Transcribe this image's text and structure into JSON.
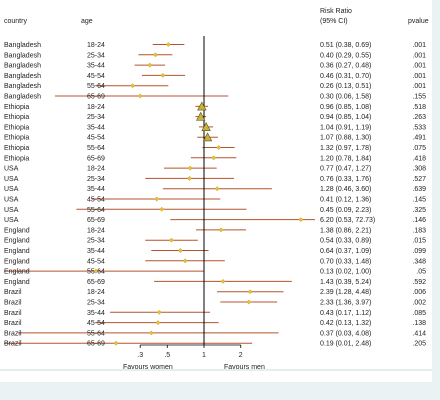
{
  "chart_data": {
    "type": "forest",
    "headers": {
      "country": "country",
      "age": "age",
      "rr_line1": "Risk Ratio",
      "rr_line2": "(95% CI)",
      "pvalue": "pvalue"
    },
    "x_axis": {
      "scale": "log",
      "ticks": [
        {
          "value": 0.3,
          "label": ".3"
        },
        {
          "value": 0.5,
          "label": ".5"
        },
        {
          "value": 1,
          "label": "1"
        },
        {
          "value": 2,
          "label": "2"
        }
      ],
      "reference_line": 1,
      "left_label": "Favours women",
      "right_label": "Favours men"
    },
    "rows": [
      {
        "country": "Bangladesh",
        "age": "18-24",
        "rr": 0.51,
        "lo": 0.38,
        "hi": 0.69,
        "ci_text": "0.51 (0.38, 0.69)",
        "p": ".001",
        "marker": "diamond"
      },
      {
        "country": "Bangladesh",
        "age": "25-34",
        "rr": 0.4,
        "lo": 0.29,
        "hi": 0.55,
        "ci_text": "0.40 (0.29, 0.55)",
        "p": ".001",
        "marker": "diamond"
      },
      {
        "country": "Bangladesh",
        "age": "35-44",
        "rr": 0.36,
        "lo": 0.27,
        "hi": 0.48,
        "ci_text": "0.36 (0.27, 0.48)",
        "p": ".001",
        "marker": "diamond"
      },
      {
        "country": "Bangladesh",
        "age": "45-54",
        "rr": 0.46,
        "lo": 0.31,
        "hi": 0.7,
        "ci_text": "0.46 (0.31, 0.70)",
        "p": ".001",
        "marker": "diamond"
      },
      {
        "country": "Bangladesh",
        "age": "55-64",
        "rr": 0.26,
        "lo": 0.13,
        "hi": 0.51,
        "ci_text": "0.26 (0.13, 0.51)",
        "p": ".001",
        "marker": "diamond"
      },
      {
        "country": "Bangladesh",
        "age": "65-69",
        "rr": 0.3,
        "lo": 0.06,
        "hi": 1.58,
        "ci_text": "0.30 (0.06, 1.58)",
        "p": ".155",
        "marker": "diamond"
      },
      {
        "country": "Ethiopia",
        "age": "18-24",
        "rr": 0.96,
        "lo": 0.85,
        "hi": 1.08,
        "ci_text": "0.96 (0.85, 1.08)",
        "p": ".518",
        "marker": "triangle"
      },
      {
        "country": "Ethiopia",
        "age": "25-34",
        "rr": 0.94,
        "lo": 0.85,
        "hi": 1.04,
        "ci_text": "0.94 (0.85, 1.04)",
        "p": ".263",
        "marker": "triangle"
      },
      {
        "country": "Ethiopia",
        "age": "35-44",
        "rr": 1.04,
        "lo": 0.91,
        "hi": 1.19,
        "ci_text": "1.04 (0.91, 1.19)",
        "p": ".533",
        "marker": "triangle"
      },
      {
        "country": "Ethiopia",
        "age": "45-54",
        "rr": 1.07,
        "lo": 0.88,
        "hi": 1.3,
        "ci_text": "1.07 (0.88, 1.30)",
        "p": ".491",
        "marker": "triangle"
      },
      {
        "country": "Ethiopia",
        "age": "55-64",
        "rr": 1.32,
        "lo": 0.97,
        "hi": 1.78,
        "ci_text": "1.32 (0.97, 1.78)",
        "p": ".075",
        "marker": "diamond"
      },
      {
        "country": "Ethiopia",
        "age": "65-69",
        "rr": 1.2,
        "lo": 0.78,
        "hi": 1.84,
        "ci_text": "1.20 (0.78, 1.84)",
        "p": ".418",
        "marker": "diamond"
      },
      {
        "country": "USA",
        "age": "18-24",
        "rr": 0.77,
        "lo": 0.47,
        "hi": 1.27,
        "ci_text": "0.77 (0.47, 1.27)",
        "p": ".308",
        "marker": "diamond"
      },
      {
        "country": "USA",
        "age": "25-34",
        "rr": 0.76,
        "lo": 0.33,
        "hi": 1.76,
        "ci_text": "0.76 (0.33, 1.76)",
        "p": ".527",
        "marker": "diamond"
      },
      {
        "country": "USA",
        "age": "35-44",
        "rr": 1.28,
        "lo": 0.46,
        "hi": 3.6,
        "ci_text": "1.28 (0.46, 3.60)",
        "p": ".639",
        "marker": "diamond"
      },
      {
        "country": "USA",
        "age": "45-54",
        "rr": 0.41,
        "lo": 0.12,
        "hi": 1.36,
        "ci_text": "0.41 (0.12, 1.36)",
        "p": ".145",
        "marker": "diamond"
      },
      {
        "country": "USA",
        "age": "55-64",
        "rr": 0.45,
        "lo": 0.09,
        "hi": 2.23,
        "ci_text": "0.45 (0.09, 2.23)",
        "p": ".325",
        "marker": "diamond"
      },
      {
        "country": "USA",
        "age": "65-69",
        "rr": 6.2,
        "lo": 0.53,
        "hi": 72.73,
        "ci_text": "6.20 (0.53, 72.73)",
        "p": ".146",
        "marker": "diamond"
      },
      {
        "country": "England",
        "age": "18-24",
        "rr": 1.38,
        "lo": 0.86,
        "hi": 2.21,
        "ci_text": "1.38 (0.86, 2.21)",
        "p": ".183",
        "marker": "diamond"
      },
      {
        "country": "England",
        "age": "25-34",
        "rr": 0.54,
        "lo": 0.33,
        "hi": 0.89,
        "ci_text": "0.54 (0.33, 0.89)",
        "p": ".015",
        "marker": "diamond"
      },
      {
        "country": "England",
        "age": "35-44",
        "rr": 0.64,
        "lo": 0.37,
        "hi": 1.09,
        "ci_text": "0.64 (0.37, 1.09)",
        "p": ".099",
        "marker": "diamond"
      },
      {
        "country": "England",
        "age": "45-54",
        "rr": 0.7,
        "lo": 0.33,
        "hi": 1.48,
        "ci_text": "0.70 (0.33, 1.48)",
        "p": ".348",
        "marker": "diamond"
      },
      {
        "country": "England",
        "age": "55-64",
        "rr": 0.13,
        "lo": 0.02,
        "hi": 1.0,
        "ci_text": "0.13 (0.02, 1.00)",
        "p": ".05",
        "marker": "diamond"
      },
      {
        "country": "England",
        "age": "65-69",
        "rr": 1.43,
        "lo": 0.39,
        "hi": 5.24,
        "ci_text": "1.43 (0.39, 5.24)",
        "p": ".592",
        "marker": "diamond"
      },
      {
        "country": "Brazil",
        "age": "18-24",
        "rr": 2.39,
        "lo": 1.28,
        "hi": 4.48,
        "ci_text": "2.39 (1.28, 4.48)",
        "p": ".006",
        "marker": "diamond"
      },
      {
        "country": "Brazil",
        "age": "25-34",
        "rr": 2.33,
        "lo": 1.36,
        "hi": 3.97,
        "ci_text": "2.33 (1.36, 3.97)",
        "p": ".002",
        "marker": "diamond"
      },
      {
        "country": "Brazil",
        "age": "35-44",
        "rr": 0.43,
        "lo": 0.17,
        "hi": 1.12,
        "ci_text": "0.43 (0.17, 1.12)",
        "p": ".085",
        "marker": "diamond"
      },
      {
        "country": "Brazil",
        "age": "45-54",
        "rr": 0.42,
        "lo": 0.13,
        "hi": 1.32,
        "ci_text": "0.42 (0.13, 1.32)",
        "p": ".138",
        "marker": "diamond"
      },
      {
        "country": "Brazil",
        "age": "55-64",
        "rr": 0.37,
        "lo": 0.03,
        "hi": 4.08,
        "ci_text": "0.37 (0.03, 4.08)",
        "p": ".414",
        "marker": "diamond"
      },
      {
        "country": "Brazil",
        "age": "65-69",
        "rr": 0.19,
        "lo": 0.01,
        "hi": 2.48,
        "ci_text": "0.19 (0.01, 2.48)",
        "p": ".205",
        "marker": "diamond"
      }
    ],
    "colors": {
      "ci_line": "#b5532f",
      "marker_fill": "#f2c21f",
      "marker_stroke": "#9a8a2a",
      "triangle_fill": "#c9b23a",
      "triangle_stroke": "#5a5220",
      "reference_line": "#000000",
      "text": "#222222"
    }
  }
}
